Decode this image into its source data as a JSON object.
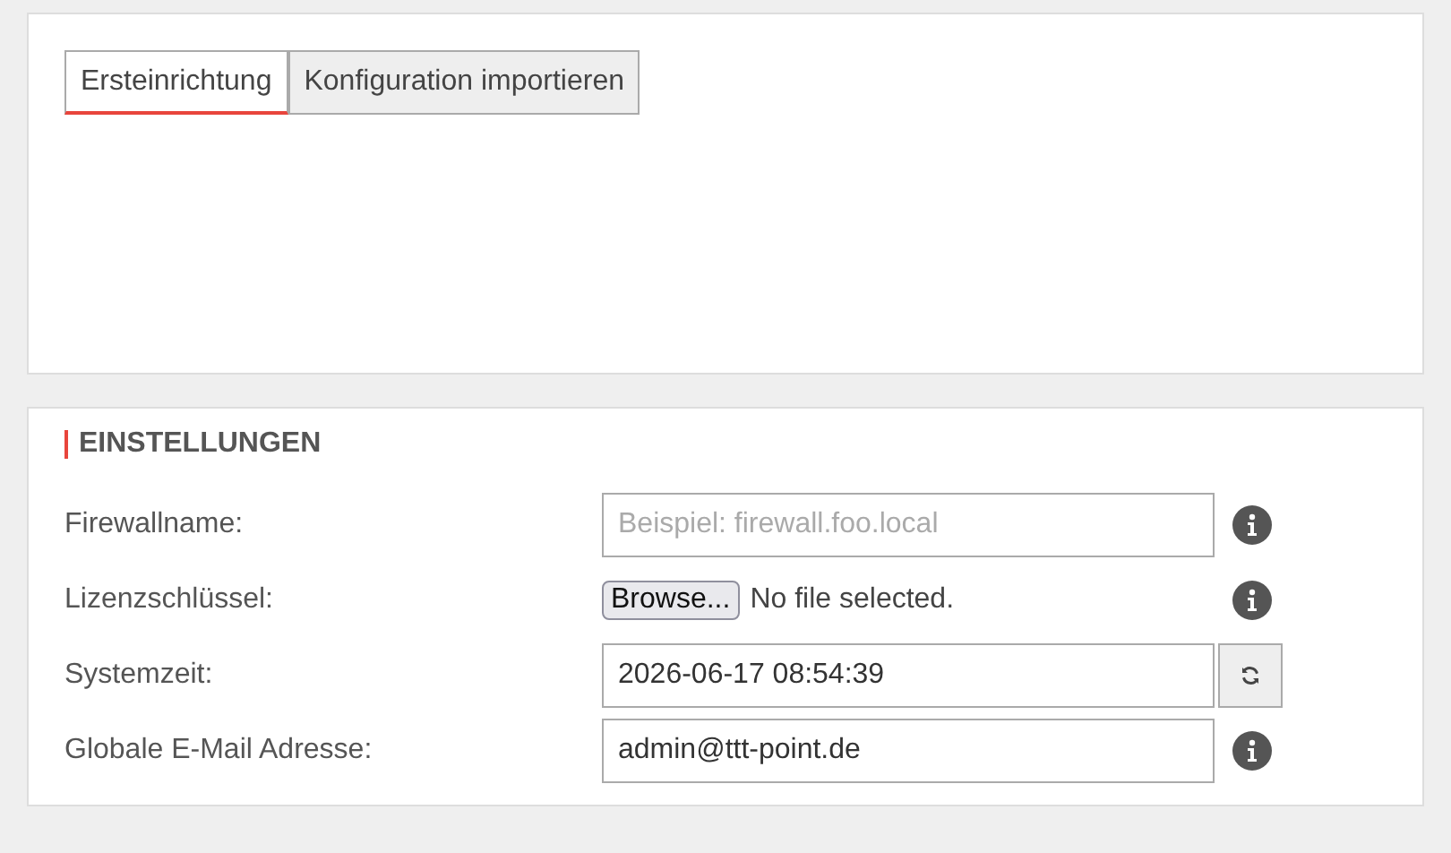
{
  "tabs": [
    {
      "label": "Ersteinrichtung",
      "selected": true
    },
    {
      "label": "Konfiguration importieren",
      "selected": false
    }
  ],
  "settings": {
    "title": "EINSTELLUNGEN",
    "rows": [
      {
        "kind": "text",
        "label": "Firewallname:",
        "placeholder": "Beispiel: firewall.foo.local",
        "action": {
          "kind": "info"
        }
      },
      {
        "kind": "file",
        "label": "Lizenzschlüssel:",
        "button": "Browse...",
        "status": "No file selected.",
        "action": {
          "kind": "info"
        }
      },
      {
        "kind": "text",
        "label": "Systemzeit:",
        "value": "2026-06-17 08:54:39",
        "action": {
          "kind": "refresh"
        }
      },
      {
        "kind": "text",
        "label": "Globale E-Mail Adresse:",
        "value": "admin@ttt-point.de",
        "action": {
          "kind": "info"
        }
      }
    ]
  }
}
